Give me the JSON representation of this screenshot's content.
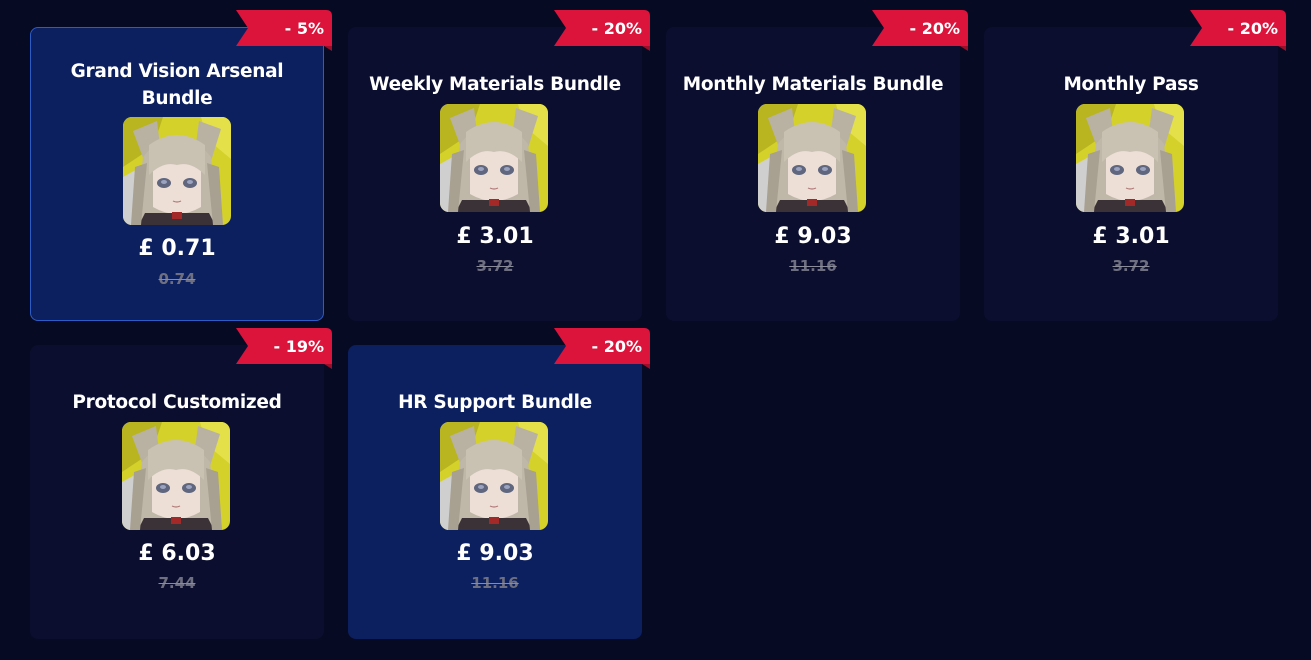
{
  "products": [
    {
      "title": "Grand Vision Arsenal Bundle",
      "price": "£ 0.71",
      "original_price": "0.74",
      "discount": "- 5%",
      "state": "selected"
    },
    {
      "title": "Weekly Materials Bundle",
      "price": "£ 3.01",
      "original_price": "3.72",
      "discount": "- 20%",
      "state": "normal"
    },
    {
      "title": "Monthly Materials Bundle",
      "price": "£ 9.03",
      "original_price": "11.16",
      "discount": "- 20%",
      "state": "normal"
    },
    {
      "title": "Monthly Pass",
      "price": "£ 3.01",
      "original_price": "3.72",
      "discount": "- 20%",
      "state": "normal"
    },
    {
      "title": "Protocol Customized",
      "price": "£ 6.03",
      "original_price": "7.44",
      "discount": "- 19%",
      "state": "normal"
    },
    {
      "title": "HR Support Bundle",
      "price": "£ 9.03",
      "original_price": "11.16",
      "discount": "- 20%",
      "state": "hovered"
    }
  ],
  "colors": {
    "page_background": "#070a23",
    "card_background": "#0b0e2e",
    "card_highlight": "#0c1f5e",
    "selected_border": "#2e5cc6",
    "discount_ribbon": "#dc143c",
    "old_price": "#6e6f80"
  },
  "icons": {
    "product_thumbnail": "character-portrait-icon",
    "discount_badge": "ribbon-banner-icon"
  }
}
